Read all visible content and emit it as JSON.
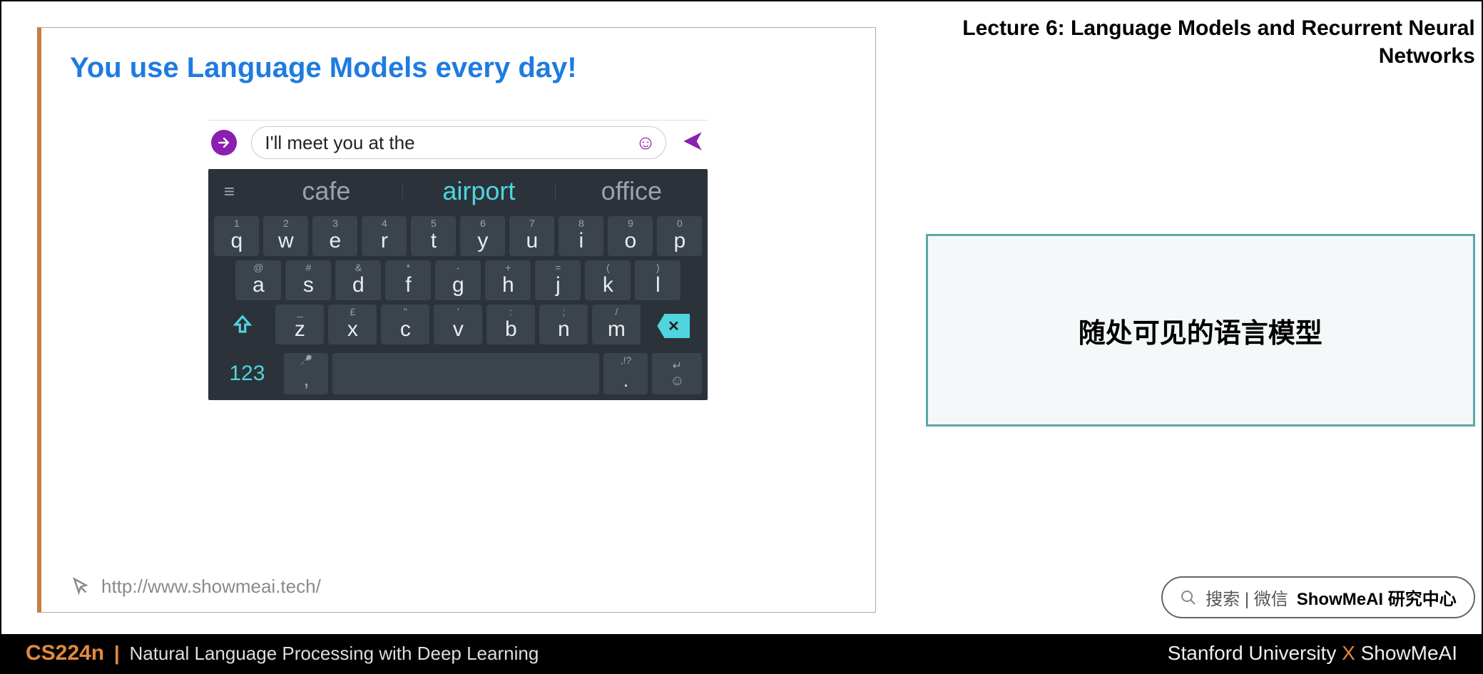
{
  "lecture_header": "Lecture 6:  Language Models and Recurrent Neural Networks",
  "slide": {
    "title": "You use Language Models every day!",
    "message_text": "I'll meet you at the",
    "suggestions": [
      "cafe",
      "airport",
      "office"
    ],
    "active_suggestion_index": 1,
    "row1": [
      {
        "sym": "1",
        "main": "q"
      },
      {
        "sym": "2",
        "main": "w"
      },
      {
        "sym": "3",
        "main": "e"
      },
      {
        "sym": "4",
        "main": "r"
      },
      {
        "sym": "5",
        "main": "t"
      },
      {
        "sym": "6",
        "main": "y"
      },
      {
        "sym": "7",
        "main": "u"
      },
      {
        "sym": "8",
        "main": "i"
      },
      {
        "sym": "9",
        "main": "o"
      },
      {
        "sym": "0",
        "main": "p"
      }
    ],
    "row2": [
      {
        "sym": "@",
        "main": "a"
      },
      {
        "sym": "#",
        "main": "s"
      },
      {
        "sym": "&",
        "main": "d"
      },
      {
        "sym": "*",
        "main": "f"
      },
      {
        "sym": "-",
        "main": "g"
      },
      {
        "sym": "+",
        "main": "h"
      },
      {
        "sym": "=",
        "main": "j"
      },
      {
        "sym": "(",
        "main": "k"
      },
      {
        "sym": ")",
        "main": "l"
      }
    ],
    "row3": [
      {
        "sym": "_",
        "main": "z"
      },
      {
        "sym": "£",
        "main": "x"
      },
      {
        "sym": "\"",
        "main": "c"
      },
      {
        "sym": "'",
        "main": "v"
      },
      {
        "sym": ":",
        "main": "b"
      },
      {
        "sym": ";",
        "main": "n"
      },
      {
        "sym": "/",
        "main": "m"
      }
    ],
    "num_key": "123",
    "comma_key": ",",
    "period_key": ".",
    "period_sym": ",!?",
    "footer_url": "http://www.showmeai.tech/"
  },
  "callout": "随处可见的语言模型",
  "search": {
    "prefix": "搜索 | 微信",
    "bold": "ShowMeAI 研究中心"
  },
  "bottom": {
    "course_code": "CS224n",
    "course_name": "Natural Language Processing with Deep Learning",
    "uni": "Stanford University",
    "org": "ShowMeAI"
  }
}
